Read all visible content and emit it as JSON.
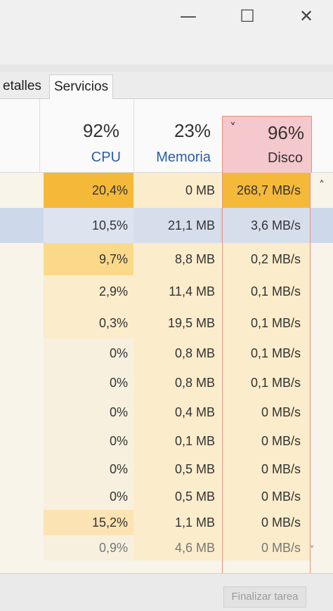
{
  "window": {
    "minimize_glyph": "—",
    "maximize_glyph": "☐",
    "close_glyph": "✕"
  },
  "tabs": [
    {
      "label": "etalles"
    },
    {
      "label": "Servicios"
    }
  ],
  "columns": {
    "cpu": {
      "percent": "92%",
      "label": "CPU"
    },
    "memory": {
      "percent": "23%",
      "label": "Memoria"
    },
    "disk": {
      "percent": "96%",
      "label": "Disco",
      "sort_glyph": "˅"
    }
  },
  "rows": [
    {
      "cpu": "20,4%",
      "memory": "0 MB",
      "disk": "268,7 MB/s"
    },
    {
      "cpu": "10,5%",
      "memory": "21,1 MB",
      "disk": "3,6 MB/s"
    },
    {
      "cpu": "9,7%",
      "memory": "8,8 MB",
      "disk": "0,2 MB/s"
    },
    {
      "cpu": "2,9%",
      "memory": "11,4 MB",
      "disk": "0,1 MB/s"
    },
    {
      "cpu": "0,3%",
      "memory": "19,5 MB",
      "disk": "0,1 MB/s"
    },
    {
      "cpu": "0%",
      "memory": "0,8 MB",
      "disk": "0,1 MB/s"
    },
    {
      "cpu": "0%",
      "memory": "0,8 MB",
      "disk": "0,1 MB/s"
    },
    {
      "cpu": "0%",
      "memory": "0,4 MB",
      "disk": "0 MB/s"
    },
    {
      "cpu": "0%",
      "memory": "0,1 MB",
      "disk": "0 MB/s"
    },
    {
      "cpu": "0%",
      "memory": "0,5 MB",
      "disk": "0 MB/s"
    },
    {
      "cpu": "0%",
      "memory": "0,5 MB",
      "disk": "0 MB/s"
    },
    {
      "cpu": "15,2%",
      "memory": "1,1 MB",
      "disk": "0 MB/s"
    },
    {
      "cpu": "0,9%",
      "memory": "4,6 MB",
      "disk": "0 MB/s"
    }
  ],
  "colors": {
    "heat_high": "#f5b93a",
    "heat_med": "#fbd98a",
    "heat_low": "#fbeccb",
    "selected_row": "#cdd9ea",
    "disk_header": "#f4c8cc",
    "disk_border": "#e98f7a"
  },
  "scrollbar": {
    "up_glyph": "˄",
    "down_glyph": "˅"
  },
  "footer": {
    "end_task_label": "Finalizar tarea"
  }
}
